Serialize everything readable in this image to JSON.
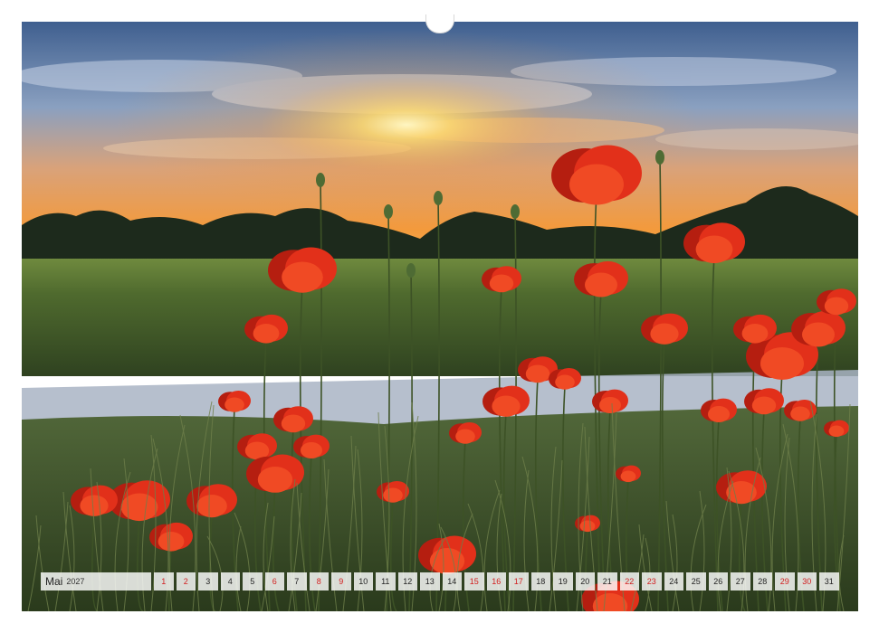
{
  "calendar": {
    "month": "Mai",
    "year": "2027",
    "days": [
      "1",
      "2",
      "3",
      "4",
      "5",
      "6",
      "7",
      "8",
      "9",
      "10",
      "11",
      "12",
      "13",
      "14",
      "15",
      "16",
      "17",
      "18",
      "19",
      "20",
      "21",
      "22",
      "23",
      "24",
      "25",
      "26",
      "27",
      "28",
      "29",
      "30",
      "31"
    ],
    "highlighted_days": [
      "1",
      "2",
      "6",
      "8",
      "9",
      "15",
      "16",
      "17",
      "22",
      "23",
      "29",
      "30"
    ]
  },
  "photo": {
    "subject": "poppy field at sunset",
    "colors": {
      "sky_top": "#3f5f8f",
      "sky_glow": "#f39a3c",
      "sun": "#fff6c2",
      "tree_line": "#1d2a1c",
      "field": "#4f6a2e",
      "path": "#a9b4c4",
      "poppy": "#e2301a",
      "poppy_dark": "#b51e10",
      "grass": "#3d5226"
    }
  }
}
